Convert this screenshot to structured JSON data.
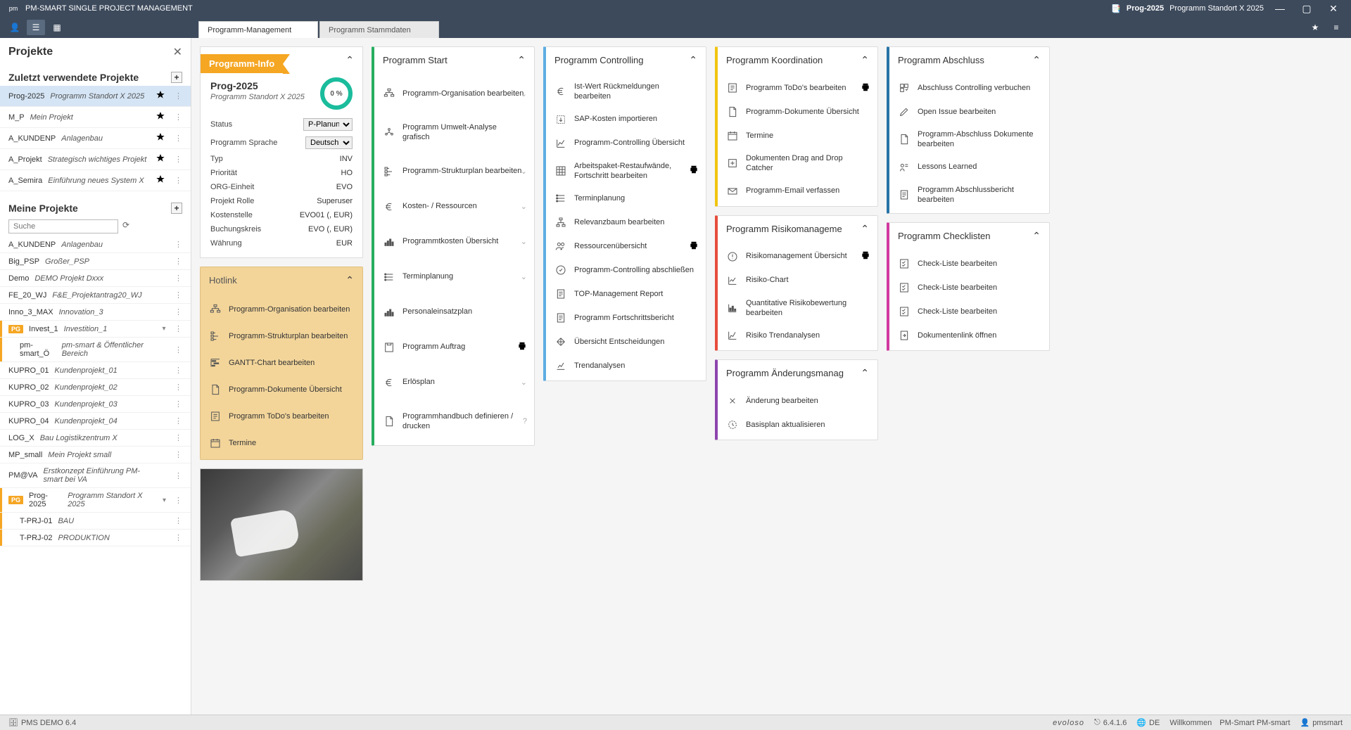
{
  "titlebar": {
    "app": "PM-SMART SINGLE PROJECT MANAGEMENT",
    "proj_code": "Prog-2025",
    "proj_name": "Programm Standort X 2025"
  },
  "tabs": [
    {
      "label": "Programm-Management",
      "active": true
    },
    {
      "label": "Programm Stammdaten",
      "active": false
    }
  ],
  "sidebar": {
    "title": "Projekte",
    "recent_title": "Zuletzt verwendete Projekte",
    "my_title": "Meine Projekte",
    "search_placeholder": "Suche",
    "recent": [
      {
        "code": "Prog-2025",
        "name": "Programm Standort X 2025",
        "fav": false,
        "selected": true
      },
      {
        "code": "M_P",
        "name": "Mein Projekt",
        "fav": true
      },
      {
        "code": "A_KUNDENP",
        "name": "Anlagenbau",
        "fav": true
      },
      {
        "code": "A_Projekt",
        "name": "Strategisch wichtiges Projekt",
        "fav": true
      },
      {
        "code": "A_Semira",
        "name": "Einführung neues System X",
        "fav": true
      }
    ],
    "mine": [
      {
        "code": "A_KUNDENP",
        "name": "Anlagenbau"
      },
      {
        "code": "Big_PSP",
        "name": "Großer_PSP"
      },
      {
        "code": "Demo",
        "name": "DEMO Projekt Dxxx"
      },
      {
        "code": "FE_20_WJ",
        "name": "F&E_Projektantrag20_WJ"
      },
      {
        "code": "Inno_3_MAX",
        "name": "Innovation_3"
      },
      {
        "badge": "PG",
        "code": "Invest_1",
        "name": "Investition_1",
        "expandable": true,
        "bar": "#f5a623"
      },
      {
        "indent": true,
        "code": "pm-smart_Ö",
        "name": "pm-smart & Öffentlicher Bereich",
        "bar": "#f5a623"
      },
      {
        "code": "KUPRO_01",
        "name": "Kundenprojekt_01"
      },
      {
        "code": "KUPRO_02",
        "name": "Kundenprojekt_02"
      },
      {
        "code": "KUPRO_03",
        "name": "Kundenprojekt_03"
      },
      {
        "code": "KUPRO_04",
        "name": "Kundenprojekt_04"
      },
      {
        "code": "LOG_X",
        "name": "Bau Logistikzentrum X"
      },
      {
        "code": "MP_small",
        "name": "Mein Projekt small"
      },
      {
        "code": "PM@VA",
        "name": "Erstkonzept Einführung PM-smart bei VA"
      },
      {
        "badge": "PG",
        "code": "Prog-2025",
        "name": "Programm Standort X 2025",
        "expandable": true,
        "bar": "#f5a623"
      },
      {
        "indent": true,
        "code": "T-PRJ-01",
        "name": "BAU",
        "bar": "#f5a623"
      },
      {
        "indent": true,
        "code": "T-PRJ-02",
        "name": "PRODUKTION",
        "bar": "#f5a623"
      }
    ]
  },
  "info": {
    "ribbon": "Programm-Info",
    "code": "Prog-2025",
    "name": "Programm Standort X 2025",
    "progress": "0 %",
    "rows": [
      {
        "k": "Status",
        "v": "P-Planung",
        "select": true
      },
      {
        "k": "Programm Sprache",
        "v": "Deutsch",
        "select": true
      },
      {
        "k": "Typ",
        "v": "INV"
      },
      {
        "k": "Priorität",
        "v": "HO"
      },
      {
        "k": "ORG-Einheit",
        "v": "EVO"
      },
      {
        "k": "Projekt Rolle",
        "v": "Superuser"
      },
      {
        "k": "Kostenstelle",
        "v": "EVO01 (, EUR)"
      },
      {
        "k": "Buchungskreis",
        "v": "EVO (, EUR)"
      },
      {
        "k": "Währung",
        "v": "EUR"
      }
    ]
  },
  "hotlink": {
    "title": "Hotlink",
    "items": [
      {
        "icon": "org",
        "label": "Programm-Organisation bearbeiten"
      },
      {
        "icon": "wbs",
        "label": "Programm-Strukturplan bearbeiten"
      },
      {
        "icon": "gantt",
        "label": "GANTT-Chart bearbeiten"
      },
      {
        "icon": "doc",
        "label": "Programm-Dokumente Übersicht"
      },
      {
        "icon": "todo",
        "label": "Programm ToDo's bearbeiten"
      },
      {
        "icon": "cal",
        "label": "Termine"
      }
    ]
  },
  "columns": [
    {
      "title": "Programm Start",
      "color": "bl-green",
      "items": [
        {
          "icon": "org",
          "label": "Programm-Organisation bearbeiten",
          "sub": true
        },
        {
          "icon": "env",
          "label": "Programm Umwelt-Analyse grafisch"
        },
        {
          "icon": "wbs",
          "label": "Programm-Strukturplan bearbeiten",
          "sub": true
        },
        {
          "icon": "euro",
          "label": "Kosten- / Ressourcen",
          "sub": true
        },
        {
          "icon": "bars",
          "label": "Programmtkosten Übersicht",
          "sub": true
        },
        {
          "icon": "sched",
          "label": "Terminplanung",
          "sub": true
        },
        {
          "icon": "bars",
          "label": "Personaleinsatzplan"
        },
        {
          "icon": "order",
          "label": "Programm Auftrag",
          "print": true
        },
        {
          "icon": "euro",
          "label": "Erlösplan",
          "sub": true
        },
        {
          "icon": "doc",
          "label": "Programmhandbuch definieren / drucken",
          "help": true
        }
      ]
    },
    {
      "title": "Programm Controlling",
      "color": "bl-blue",
      "items": [
        {
          "icon": "euro",
          "label": "Ist-Wert Rückmeldungen bearbeiten"
        },
        {
          "icon": "import",
          "label": "SAP-Kosten importieren"
        },
        {
          "icon": "chart",
          "label": "Programm-Controlling Übersicht"
        },
        {
          "icon": "grid",
          "label": "Arbeitspaket-Restaufwände, Fortschritt bearbeiten",
          "print": true
        },
        {
          "icon": "sched",
          "label": "Terminplanung"
        },
        {
          "icon": "tree",
          "label": "Relevanzbaum bearbeiten"
        },
        {
          "icon": "people",
          "label": "Ressourcenübersicht",
          "print": true
        },
        {
          "icon": "close-c",
          "label": "Programm-Controlling abschließen"
        },
        {
          "icon": "report",
          "label": "TOP-Management Report"
        },
        {
          "icon": "report",
          "label": "Programm Fortschrittsbericht"
        },
        {
          "icon": "decide",
          "label": "Übersicht Entscheidungen"
        },
        {
          "icon": "trend",
          "label": "Trendanalysen"
        }
      ]
    }
  ],
  "col3": [
    {
      "title": "Programm Koordination",
      "color": "bl-yellow",
      "items": [
        {
          "icon": "todo",
          "label": "Programm ToDo's bearbeiten",
          "print": true
        },
        {
          "icon": "doc",
          "label": "Programm-Dokumente Übersicht"
        },
        {
          "icon": "cal",
          "label": "Termine"
        },
        {
          "icon": "drop",
          "label": "Dokumenten Drag and Drop Catcher"
        },
        {
          "icon": "mail",
          "label": "Programm-Email verfassen"
        }
      ]
    },
    {
      "title": "Programm Risikomanageme",
      "color": "bl-red",
      "items": [
        {
          "icon": "warn",
          "label": "Risikomanagement Übersicht",
          "print": true
        },
        {
          "icon": "rchart",
          "label": "Risiko-Chart"
        },
        {
          "icon": "rquant",
          "label": "Quantitative Risikobewertung bearbeiten"
        },
        {
          "icon": "rtrend",
          "label": "Risiko Trendanalysen"
        }
      ]
    },
    {
      "title": "Programm Änderungsmanag",
      "color": "bl-purple",
      "items": [
        {
          "icon": "change",
          "label": "Änderung bearbeiten"
        },
        {
          "icon": "base",
          "label": "Basisplan aktualisieren"
        }
      ]
    }
  ],
  "col4": [
    {
      "title": "Programm Abschluss",
      "color": "bl-dblue",
      "items": [
        {
          "icon": "finctl",
          "label": "Abschluss Controlling verbuchen"
        },
        {
          "icon": "pen",
          "label": "Open Issue bearbeiten"
        },
        {
          "icon": "doc",
          "label": "Programm-Abschluss Dokumente bearbeiten"
        },
        {
          "icon": "lesson",
          "label": "Lessons Learned"
        },
        {
          "icon": "report",
          "label": "Programm Abschlussbericht bearbeiten"
        }
      ]
    },
    {
      "title": "Programm Checklisten",
      "color": "bl-pink",
      "items": [
        {
          "icon": "check",
          "label": "Check-Liste bearbeiten"
        },
        {
          "icon": "check",
          "label": "Check-Liste bearbeiten"
        },
        {
          "icon": "check",
          "label": "Check-Liste bearbeiten"
        },
        {
          "icon": "link",
          "label": "Dokumentenlink öffnen"
        }
      ]
    }
  ],
  "footer": {
    "db": "PMS DEMO 6.4",
    "brand": "evoloso",
    "version": "6.4.1.6",
    "lang": "DE",
    "welcome": "Willkommen",
    "product": "PM-Smart PM-smart",
    "user": "pmsmart"
  }
}
